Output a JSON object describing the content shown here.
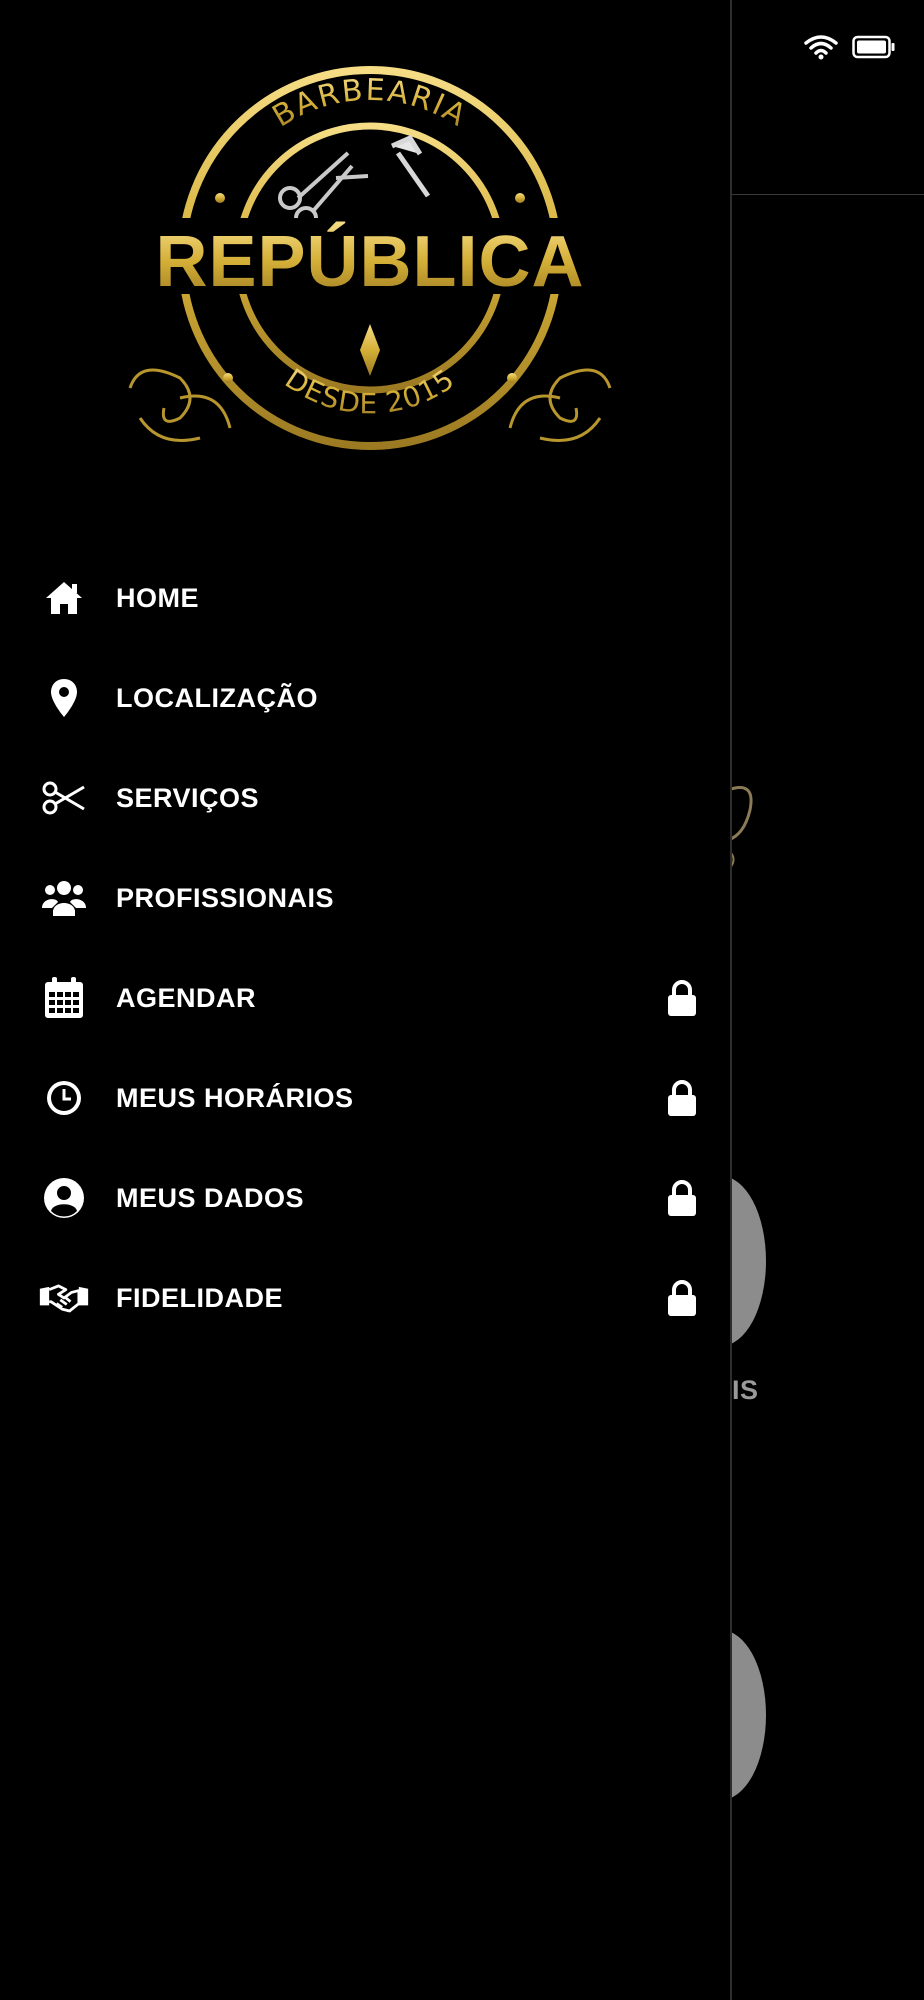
{
  "background": {
    "partial_text": "AIS"
  },
  "logo": {
    "top_text": "BARBEARIA",
    "main_text": "REPÚBLICA",
    "bottom_text": "DESDE 2015",
    "colors": {
      "gold": "#d4af37",
      "gold_light": "#f3d777",
      "gold_dark": "#8a6d1e"
    }
  },
  "menu": {
    "items": [
      {
        "label": "HOME",
        "icon": "home-icon",
        "locked": false
      },
      {
        "label": "LOCALIZAÇÃO",
        "icon": "location-pin-icon",
        "locked": false
      },
      {
        "label": "SERVIÇOS",
        "icon": "scissors-icon",
        "locked": false
      },
      {
        "label": "PROFISSIONAIS",
        "icon": "users-icon",
        "locked": false
      },
      {
        "label": "AGENDAR",
        "icon": "calendar-icon",
        "locked": true
      },
      {
        "label": "MEUS HORÁRIOS",
        "icon": "clock-icon",
        "locked": true
      },
      {
        "label": "MEUS DADOS",
        "icon": "user-circle-icon",
        "locked": true
      },
      {
        "label": "FIDELIDADE",
        "icon": "handshake-icon",
        "locked": true
      }
    ]
  },
  "colors": {
    "background": "#000000",
    "text": "#ffffff",
    "lock": "#ffffff"
  }
}
